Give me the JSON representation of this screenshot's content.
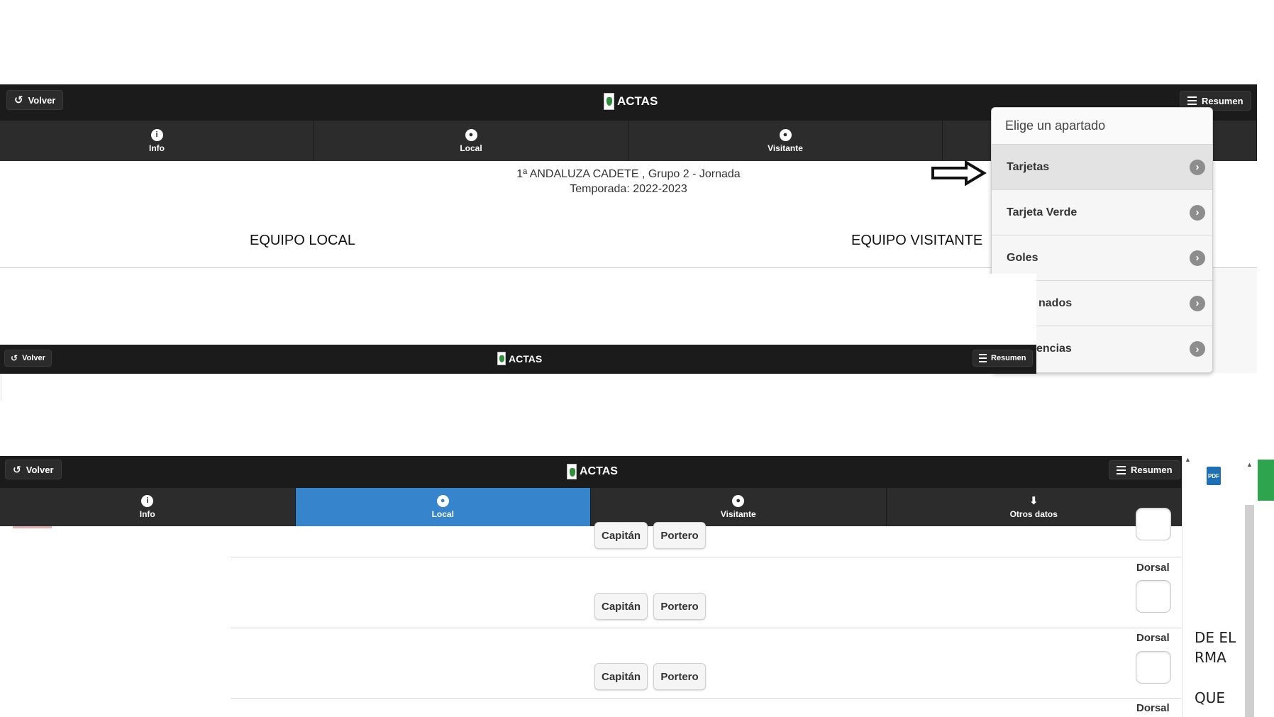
{
  "top_screen": {
    "back_label": "Volver",
    "title": "ACTAS",
    "summary_label": "Resumen",
    "tabs": [
      {
        "label": "Info",
        "icon": "info-icon"
      },
      {
        "label": "Local",
        "icon": "user-icon"
      },
      {
        "label": "Visitante",
        "icon": "user-icon"
      },
      {
        "label": "",
        "icon": ""
      }
    ],
    "competition_line": "1ª ANDALUZA CADETE , Grupo 2 - Jornada",
    "season_line": "Temporada: 2022-2023",
    "home_team_label": "EQUIPO LOCAL",
    "away_team_label": "EQUIPO VISITANTE",
    "popup": {
      "title": "Elige un apartado",
      "items": [
        "Tarjetas",
        "Tarjeta Verde",
        "Goles",
        "nados",
        "encias"
      ],
      "selected": "Tarjetas"
    }
  },
  "middle_screen": {
    "back_label": "Volver",
    "title": "ACTAS",
    "summary_label": "Resumen"
  },
  "bottom_screen": {
    "back_label": "Volver",
    "title": "ACTAS",
    "summary_label": "Resumen",
    "tabs": [
      {
        "label": "Info",
        "icon": "info-icon"
      },
      {
        "label": "Local",
        "icon": "user-icon"
      },
      {
        "label": "Visitante",
        "icon": "user-icon"
      },
      {
        "label": "Otros datos",
        "icon": "download-icon"
      }
    ],
    "active_tab": "Local",
    "captain_label": "Capitán",
    "goalkeeper_label": "Portero",
    "dorsal_label": "Dorsal",
    "side_texts": [
      "DE EL",
      "RMA",
      "QUE"
    ],
    "pdf_label": "PDF"
  },
  "colors": {
    "header_bg": "#1b1b1b",
    "nav_bg": "#2c2c2c",
    "active_tab": "#3584cc",
    "accent_green": "#2ea44f"
  }
}
